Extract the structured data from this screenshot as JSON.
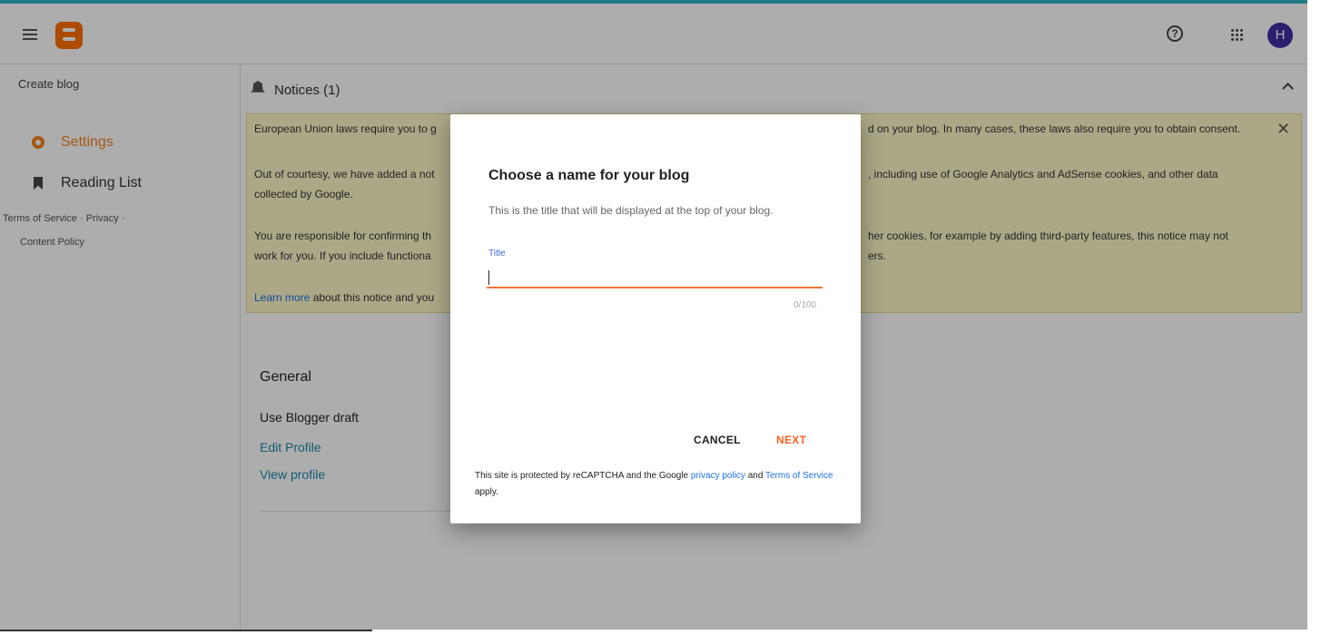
{
  "header": {
    "menu_icon": "hamburger-menu-icon",
    "logo_icon": "blogger-logo-icon",
    "help_glyph": "?",
    "avatar_initial": "H",
    "colors": {
      "top_line": "#1f7a86",
      "logo": "#ff6f00",
      "avatar": "#3f2fa3"
    }
  },
  "sidebar": {
    "create_blog": "Create blog",
    "items": [
      {
        "label": "Settings",
        "icon": "gear-icon",
        "active": true
      },
      {
        "label": "Reading List",
        "icon": "bookmark-icon",
        "active": false
      }
    ],
    "footer": {
      "terms": "Terms of Service",
      "sep1": "·",
      "privacy": "Privacy",
      "sep2": "·",
      "content_policy": "Content Policy"
    },
    "accent": "#f4811e"
  },
  "notices": {
    "title": "Notices (1)",
    "line1_left": "European Union laws require you to g",
    "line1_right": "d on your blog. In many cases, these laws also require you to obtain consent.",
    "line2_left": "Out of courtesy, we have added a not",
    "line2_right": ", including use of Google Analytics and AdSense cookies, and other data",
    "line3": "collected by Google.",
    "line4_left": "You are responsible for confirming th",
    "line4_right": "her cookies, for example by adding third-party features, this notice may not",
    "line5_left": "work for you. If you include functiona",
    "line5_right": "ers.",
    "learn_more_link": "Learn more",
    "learn_more_rest": " about this notice and you",
    "close_glyph": "✕"
  },
  "general": {
    "title": "General",
    "use_draft": "Use Blogger draft",
    "edit_profile": "Edit Profile",
    "view_profile": "View profile"
  },
  "dialog": {
    "title": "Choose a name for your blog",
    "subtitle": "This is the title that will be displayed at the top of your blog.",
    "field_label": "Title",
    "field_value": "",
    "counter": "0/100",
    "cancel": "CANCEL",
    "next": "NEXT",
    "recaptcha_text": "This site is protected by reCAPTCHA and the Google ",
    "privacy_link": "privacy policy",
    "and_text": " and ",
    "terms_link": "Terms of Service",
    "apply_text": " apply.",
    "colors": {
      "underline": "#f47536",
      "next": "#f4642a",
      "label": "#3a6ad1"
    }
  }
}
